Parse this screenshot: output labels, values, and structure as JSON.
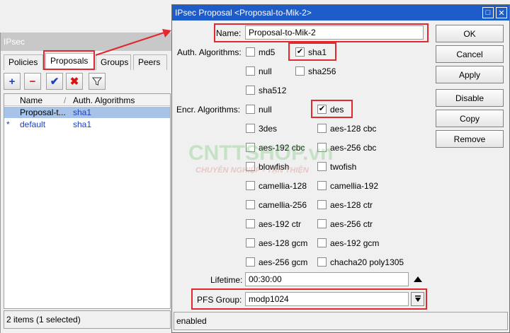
{
  "ipsec_window": {
    "title": "IPsec",
    "tabs": [
      "Policies",
      "Proposals",
      "Groups",
      "Peers"
    ],
    "toolbar": {
      "add_icon": "+",
      "remove_icon": "−",
      "enable_icon": "✔",
      "disable_icon": "✖",
      "filter_icon": "filter-icon"
    },
    "list": {
      "columns": [
        "Name",
        "Auth. Algorithms"
      ],
      "sort_indicator": "/",
      "rows": [
        {
          "marker": "",
          "name": "Proposal-t...",
          "auth": "sha1",
          "selected": true
        },
        {
          "marker": "*",
          "name": "default",
          "auth": "sha1",
          "selected": false
        }
      ]
    },
    "status": "2 items (1 selected)"
  },
  "dialog": {
    "title": "IPsec Proposal <Proposal-to-Mik-2>",
    "restore_icon": "□",
    "close_icon": "✕",
    "name_label": "Name:",
    "name_value": "Proposal-to-Mik-2",
    "auth_label": "Auth. Algorithms:",
    "auth_options": [
      {
        "label": "md5",
        "checked": false
      },
      {
        "label": "sha1",
        "checked": true
      },
      {
        "label": "null",
        "checked": false
      },
      {
        "label": "sha256",
        "checked": false
      },
      {
        "label": "sha512",
        "checked": false
      }
    ],
    "encr_label": "Encr. Algorithms:",
    "encr_options": [
      {
        "label": "null",
        "checked": false
      },
      {
        "label": "des",
        "checked": true
      },
      {
        "label": "3des",
        "checked": false
      },
      {
        "label": "aes-128 cbc",
        "checked": false
      },
      {
        "label": "aes-192 cbc",
        "checked": false
      },
      {
        "label": "aes-256 cbc",
        "checked": false
      },
      {
        "label": "blowfish",
        "checked": false
      },
      {
        "label": "twofish",
        "checked": false
      },
      {
        "label": "camellia-128",
        "checked": false
      },
      {
        "label": "camellia-192",
        "checked": false
      },
      {
        "label": "camellia-256",
        "checked": false
      },
      {
        "label": "aes-128 ctr",
        "checked": false
      },
      {
        "label": "aes-192 ctr",
        "checked": false
      },
      {
        "label": "aes-256 ctr",
        "checked": false
      },
      {
        "label": "aes-128 gcm",
        "checked": false
      },
      {
        "label": "aes-192 gcm",
        "checked": false
      },
      {
        "label": "aes-256 gcm",
        "checked": false
      },
      {
        "label": "chacha20 poly1305",
        "checked": false
      }
    ],
    "lifetime_label": "Lifetime:",
    "lifetime_value": "00:30:00",
    "pfs_label": "PFS Group:",
    "pfs_value": "modp1024",
    "buttons": [
      "OK",
      "Cancel",
      "Apply",
      "Disable",
      "Copy",
      "Remove"
    ],
    "status": "enabled"
  },
  "watermark": {
    "brand": "CNTTSHOP.vn",
    "tagline": "CHUYÊN NGHIỆP - TẬN THIỆN"
  },
  "colors": {
    "titlebar": "#1e5cc9",
    "highlight": "#e0282e",
    "selection": "#a7c4e8",
    "link_text": "#1a3fbf"
  }
}
